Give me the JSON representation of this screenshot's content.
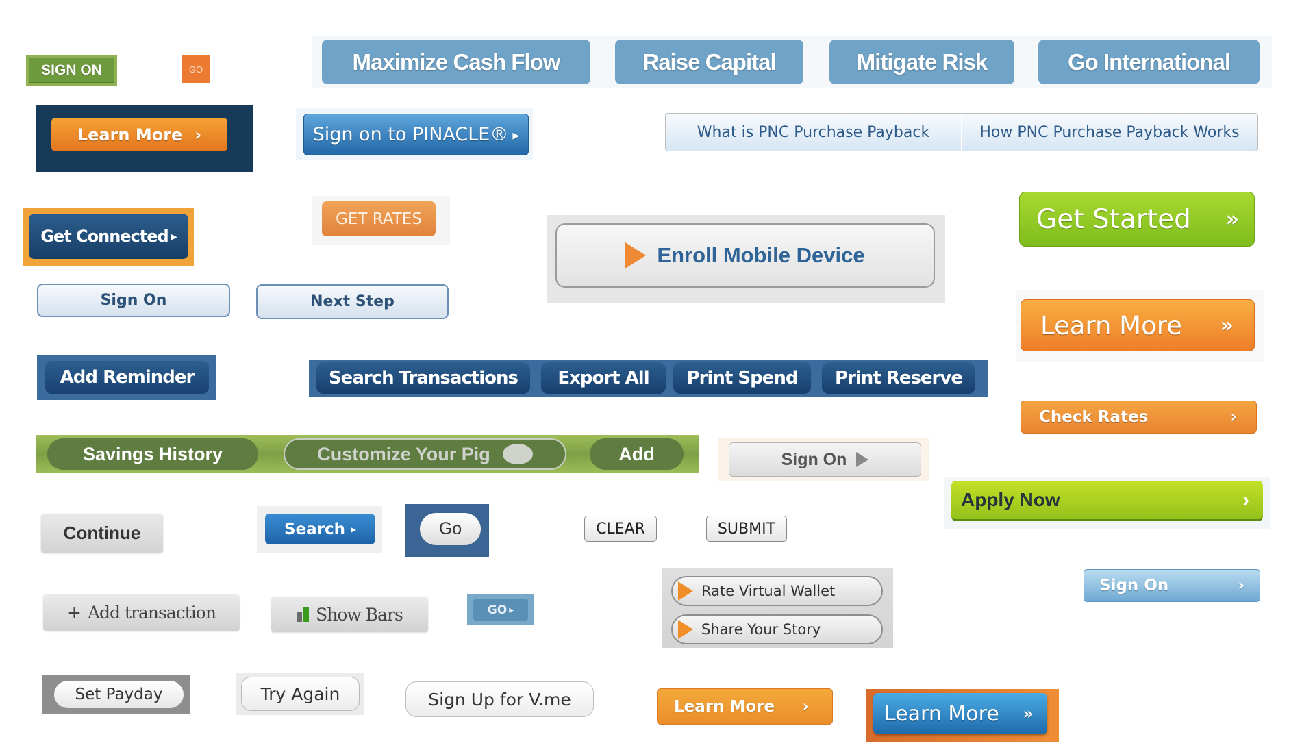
{
  "colors": {
    "pnc_orange": "#ec7a31",
    "pnc_navy": "#173e66",
    "pnc_blue": "#6fa3c7",
    "green": "#7fbc1d",
    "lime": "#94c11a",
    "savings_green": "#5f7d41"
  },
  "buttons": {
    "sign_on_green": "SIGN ON",
    "go_orange": "GO",
    "top_nav": [
      "Maximize Cash Flow",
      "Raise Capital",
      "Mitigate Risk",
      "Go International"
    ],
    "learn_more_navy": "Learn More",
    "learn_more_navy_chevron": "›",
    "pinacle": "Sign on to PINACLE®",
    "pinacle_arrow": "▸",
    "pnc_tabs": [
      "What is PNC Purchase Payback",
      "How PNC Purchase Payback Works"
    ],
    "get_connected": "Get Connected",
    "get_connected_arrow": "▸",
    "get_rates": "GET RATES",
    "enroll_mobile": "Enroll Mobile Device",
    "get_started": "Get Started",
    "get_started_chevron": "»",
    "sign_on_light": "Sign On",
    "next_step": "Next Step",
    "learn_more_big": "Learn More",
    "learn_more_big_chevron": "»",
    "add_reminder": "Add Reminder",
    "transactions_bar": [
      "Search Transactions",
      "Export All",
      "Print Spend",
      "Print Reserve"
    ],
    "check_rates": "Check Rates",
    "check_rates_chevron": "›",
    "savings_bar": [
      "Savings History",
      "Customize Your Pig",
      "Add"
    ],
    "sign_on_grey": "Sign On",
    "apply_now": "Apply Now",
    "apply_now_chevron": "›",
    "continue": "Continue",
    "search_blue": "Search",
    "search_blue_arrow": "▸",
    "go_navy": "Go",
    "clear": "CLEAR",
    "submit": "SUBMIT",
    "rate_virtual_wallet": "Rate Virtual Wallet",
    "share_your_story": "Share Your Story",
    "sign_on_light_blue": "Sign On",
    "sign_on_light_blue_chevron": "›",
    "add_transaction": "Add transaction",
    "add_transaction_plus": "+",
    "show_bars": "Show Bars",
    "go_small": "GO",
    "go_small_arrow": "▸",
    "set_payday": "Set Payday",
    "try_again": "Try Again",
    "sign_up_vme": "Sign Up for V.me",
    "learn_more_orange_small": "Learn More",
    "learn_more_orange_small_chevron": "›",
    "learn_more_blue": "Learn More",
    "learn_more_blue_chevron": "»"
  }
}
